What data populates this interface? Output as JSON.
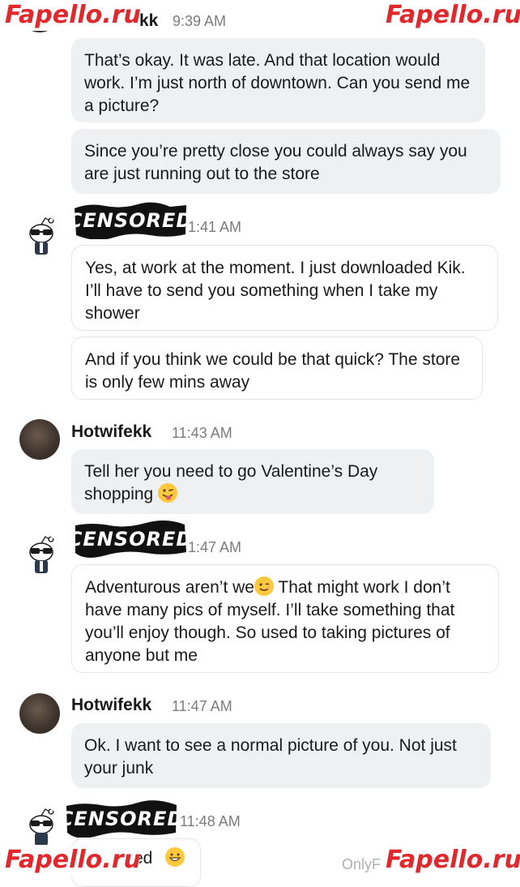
{
  "watermarks": {
    "top_left": "Fapello.ru",
    "top_right": "Fapello.ru",
    "bottom_left": "Fapello.ru",
    "bottom_right": "Fapello.ru"
  },
  "censor_label": "CENSORED",
  "footer_faint": "OnlyF",
  "messages": [
    {
      "name_fragment": "kk",
      "time": "9:39 AM",
      "bubbles": [
        "That’s okay. It was late. And that location would work. I’m just north of downtown. Can you send me a picture?",
        "Since you’re pretty close you could always say you are just running out to the store"
      ]
    },
    {
      "time_fragment": "1:41 AM",
      "bubbles": [
        "Yes, at work at the moment. I just downloaded Kik. I’ll have to send you something when I take my shower",
        "And if you think we could be that quick? The store is only few mins away"
      ]
    },
    {
      "name": "Hotwifekk",
      "time": "11:43 AM",
      "bubble_text": "Tell her you need to go Valentine’s Day shopping",
      "emoji": "winking-tongue"
    },
    {
      "time_fragment": "1:47 AM",
      "bubble_part1": "Adventurous aren’t we",
      "emoji": "wink",
      "bubble_part2": " That might work I don’t have many pics of myself. I’ll take something that you’ll enjoy though. So used to taking pictures of anyone but me"
    },
    {
      "name": "Hotwifekk",
      "time": "11:47 AM",
      "bubble_text": "Ok. I want to see a normal picture of you. Not just your junk"
    },
    {
      "time": "11:48 AM",
      "partial_bubble_text": "ed",
      "emoji": "grinning"
    }
  ],
  "colors": {
    "watermark_red": "#e0282d",
    "bubble_gray": "#eef0f2",
    "timestamp_gray": "#7c7c7c"
  }
}
